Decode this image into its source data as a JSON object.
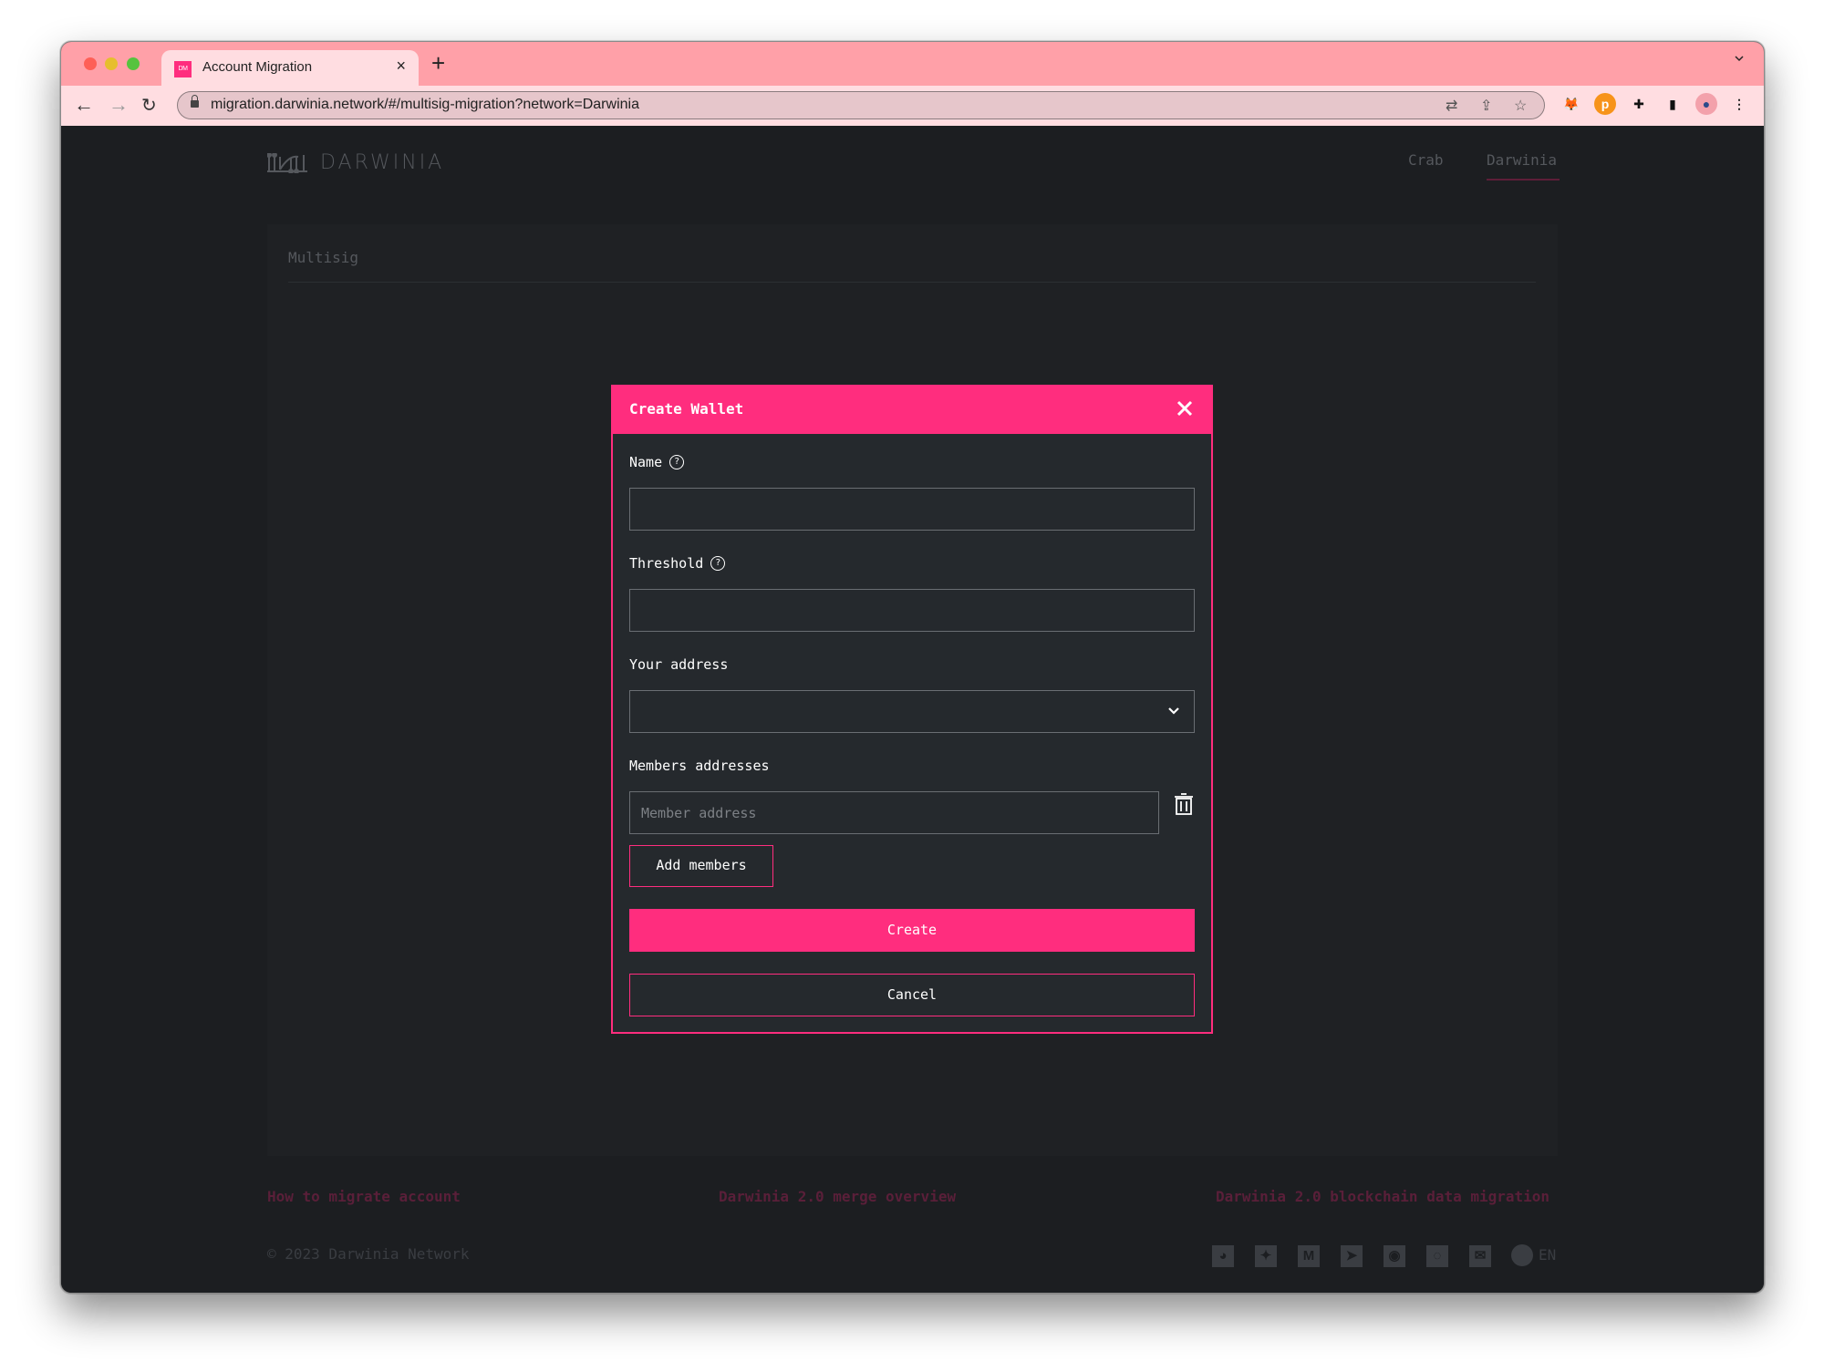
{
  "browser": {
    "tab_title": "Account Migration",
    "favicon_text": "DM",
    "url": "migration.darwinia.network/#/multisig-migration?network=Darwinia",
    "new_tab_label": "+",
    "tab_close_label": "×",
    "extensions": [
      "metamask-icon",
      "polkadot-icon",
      "extensions-puzzle-icon",
      "side-panel-icon",
      "profile-avatar"
    ]
  },
  "app": {
    "brand": "DARWINIA",
    "nav": [
      {
        "label": "Crab",
        "active": false
      },
      {
        "label": "Darwinia",
        "active": true
      }
    ],
    "accent_color": "#ff2d7e",
    "card_title": "Multisig"
  },
  "modal": {
    "title": "Create Wallet",
    "fields": {
      "name": {
        "label": "Name",
        "value": "",
        "placeholder": "",
        "help": "?"
      },
      "threshold": {
        "label": "Threshold",
        "value": "",
        "placeholder": "",
        "help": "?"
      },
      "your_address": {
        "label": "Your address",
        "selected": ""
      },
      "members": {
        "label": "Members addresses",
        "items": [
          {
            "value": "",
            "placeholder": "Member address"
          }
        ]
      }
    },
    "buttons": {
      "add_members": "Add members",
      "create": "Create",
      "cancel": "Cancel"
    }
  },
  "footer": {
    "links": [
      "How to migrate account",
      "Darwinia 2.0 merge overview",
      "Darwinia 2.0 blockchain data migration"
    ],
    "copyright": "© 2023 Darwinia Network",
    "social_icons": [
      "github-icon",
      "twitter-icon",
      "medium-icon",
      "telegram-icon",
      "discord-icon",
      "element-icon",
      "email-icon"
    ],
    "language": "EN"
  }
}
